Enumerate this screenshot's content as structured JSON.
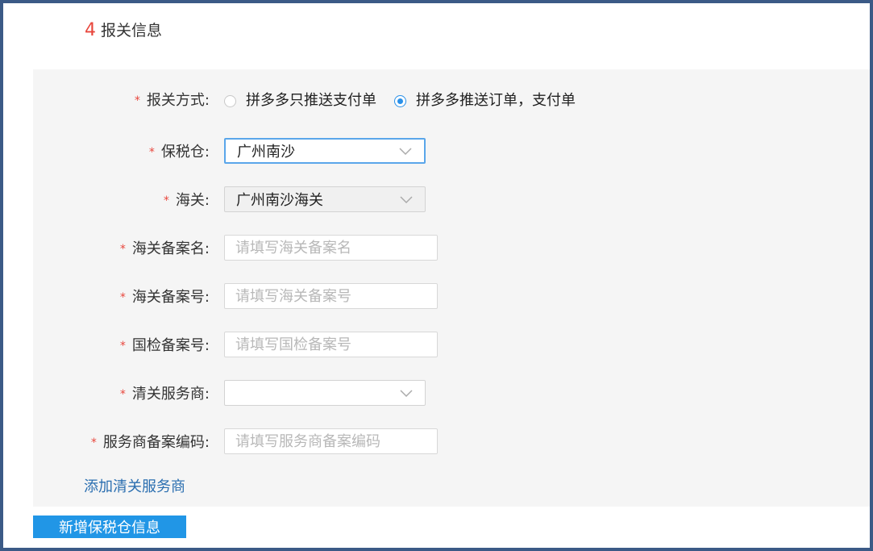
{
  "section": {
    "number": "4",
    "title": "报关信息"
  },
  "form": {
    "required_mark": "*",
    "declare_method": {
      "label": "报关方式:",
      "options": [
        {
          "label": "拼多多只推送支付单",
          "checked": false
        },
        {
          "label": "拼多多推送订单，支付单",
          "checked": true
        }
      ]
    },
    "bonded_warehouse": {
      "label": "保税仓:",
      "value": "广州南沙"
    },
    "customs": {
      "label": "海关:",
      "value": "广州南沙海关"
    },
    "customs_record_name": {
      "label": "海关备案名:",
      "placeholder": "请填写海关备案名"
    },
    "customs_record_no": {
      "label": "海关备案号:",
      "placeholder": "请填写海关备案号"
    },
    "inspection_record_no": {
      "label": "国检备案号:",
      "placeholder": "请填写国检备案号"
    },
    "clearance_provider": {
      "label": "清关服务商:",
      "value": ""
    },
    "provider_record_code": {
      "label": "服务商备案编码:",
      "placeholder": "请填写服务商备案编码"
    }
  },
  "add_provider_link": "添加清关服务商",
  "add_warehouse_button": "新增保税仓信息",
  "colors": {
    "accent": "#2196e6",
    "required": "#e8463c",
    "link": "#2a6eb0"
  }
}
